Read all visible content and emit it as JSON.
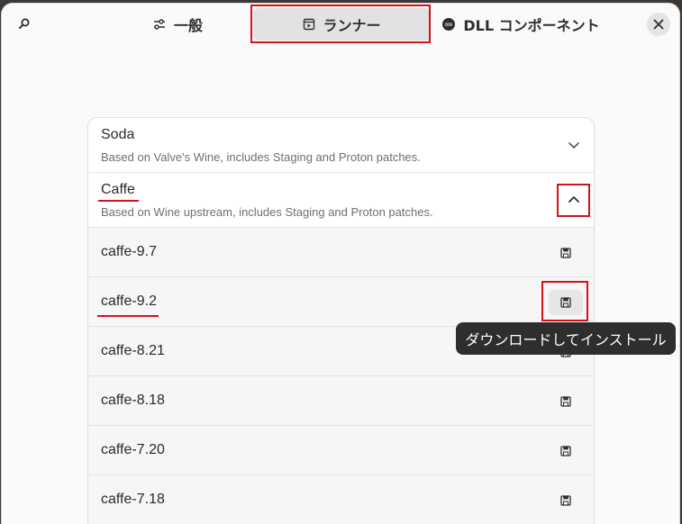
{
  "header": {
    "search_icon": "search-icon",
    "tabs": [
      {
        "label": "一般",
        "icon": "sliders-icon"
      },
      {
        "label": "ランナー",
        "icon": "runner-icon"
      },
      {
        "label": "DLL コンポーネント",
        "icon": "gpu-icon"
      }
    ],
    "close_icon": "close-icon"
  },
  "runners": {
    "groups": [
      {
        "title": "Soda",
        "subtitle": "Based on Valve's Wine, includes Staging and Proton patches.",
        "expanded": false
      },
      {
        "title": "Caffe",
        "subtitle": "Based on Wine upstream, includes Staging and Proton patches.",
        "expanded": true
      }
    ],
    "caffe_items": [
      {
        "label": "caffe-9.7"
      },
      {
        "label": "caffe-9.2"
      },
      {
        "label": "caffe-8.21"
      },
      {
        "label": "caffe-8.18"
      },
      {
        "label": "caffe-7.20"
      },
      {
        "label": "caffe-7.18"
      }
    ]
  },
  "tooltip": {
    "text": "ダウンロードしてインストール"
  },
  "colors": {
    "highlight": "#d4121a",
    "tooltip_bg": "#2e2e2e"
  }
}
